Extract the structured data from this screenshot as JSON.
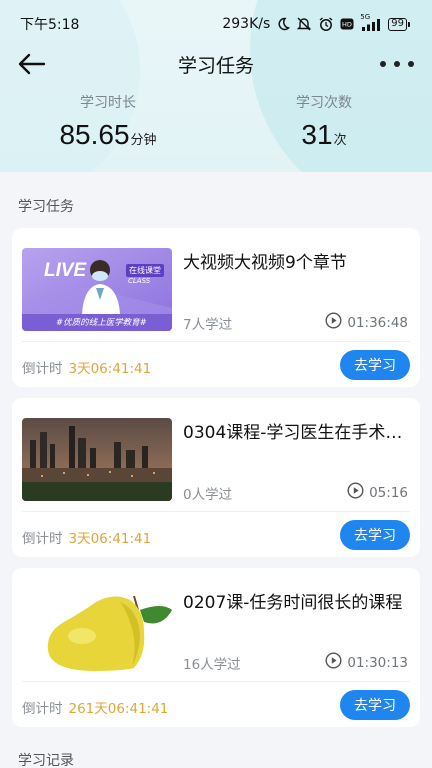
{
  "status_bar": {
    "time": "下午5:18",
    "network_speed": "293K/s",
    "icons": [
      "moon-icon",
      "mute-icon",
      "alarm-icon",
      "hd-icon",
      "5g-signal-icon"
    ],
    "signal_label": "5G",
    "battery": "99"
  },
  "nav": {
    "title": "学习任务",
    "back_icon": "arrow-left-icon",
    "more_icon": "more-dots-icon"
  },
  "stats": {
    "duration_label": "学习时长",
    "duration_value": "85.65",
    "duration_unit": "分钟",
    "count_label": "学习次数",
    "count_value": "31",
    "count_unit": "次"
  },
  "sections": {
    "tasks_title": "学习任务",
    "records_title": "学习记录"
  },
  "tasks": [
    {
      "title": "大视频大视频9个章节",
      "learners": "7人学过",
      "duration": "01:36:48",
      "countdown_label": "倒计时",
      "countdown_value": "3天06:41:41",
      "button": "去学习",
      "thumb": {
        "live_text": "LIVE",
        "badge_text": "在线课堂",
        "class_text": "CLASS",
        "slogan": "#优质的线上医学教育#"
      }
    },
    {
      "title": "0304课程-学习医生在手术…",
      "learners": "0人学过",
      "duration": "05:16",
      "countdown_label": "倒计时",
      "countdown_value": "3天06:41:41",
      "button": "去学习"
    },
    {
      "title": "0207课-任务时间很长的课程",
      "learners": "16人学过",
      "duration": "01:30:13",
      "countdown_label": "倒计时",
      "countdown_value": "261天06:41:41",
      "button": "去学习"
    }
  ],
  "colors": {
    "accent": "#1f86f0",
    "countdown": "#e0a63a",
    "header_bg": "#e6f5f7",
    "page_bg": "#f3f5f8"
  }
}
